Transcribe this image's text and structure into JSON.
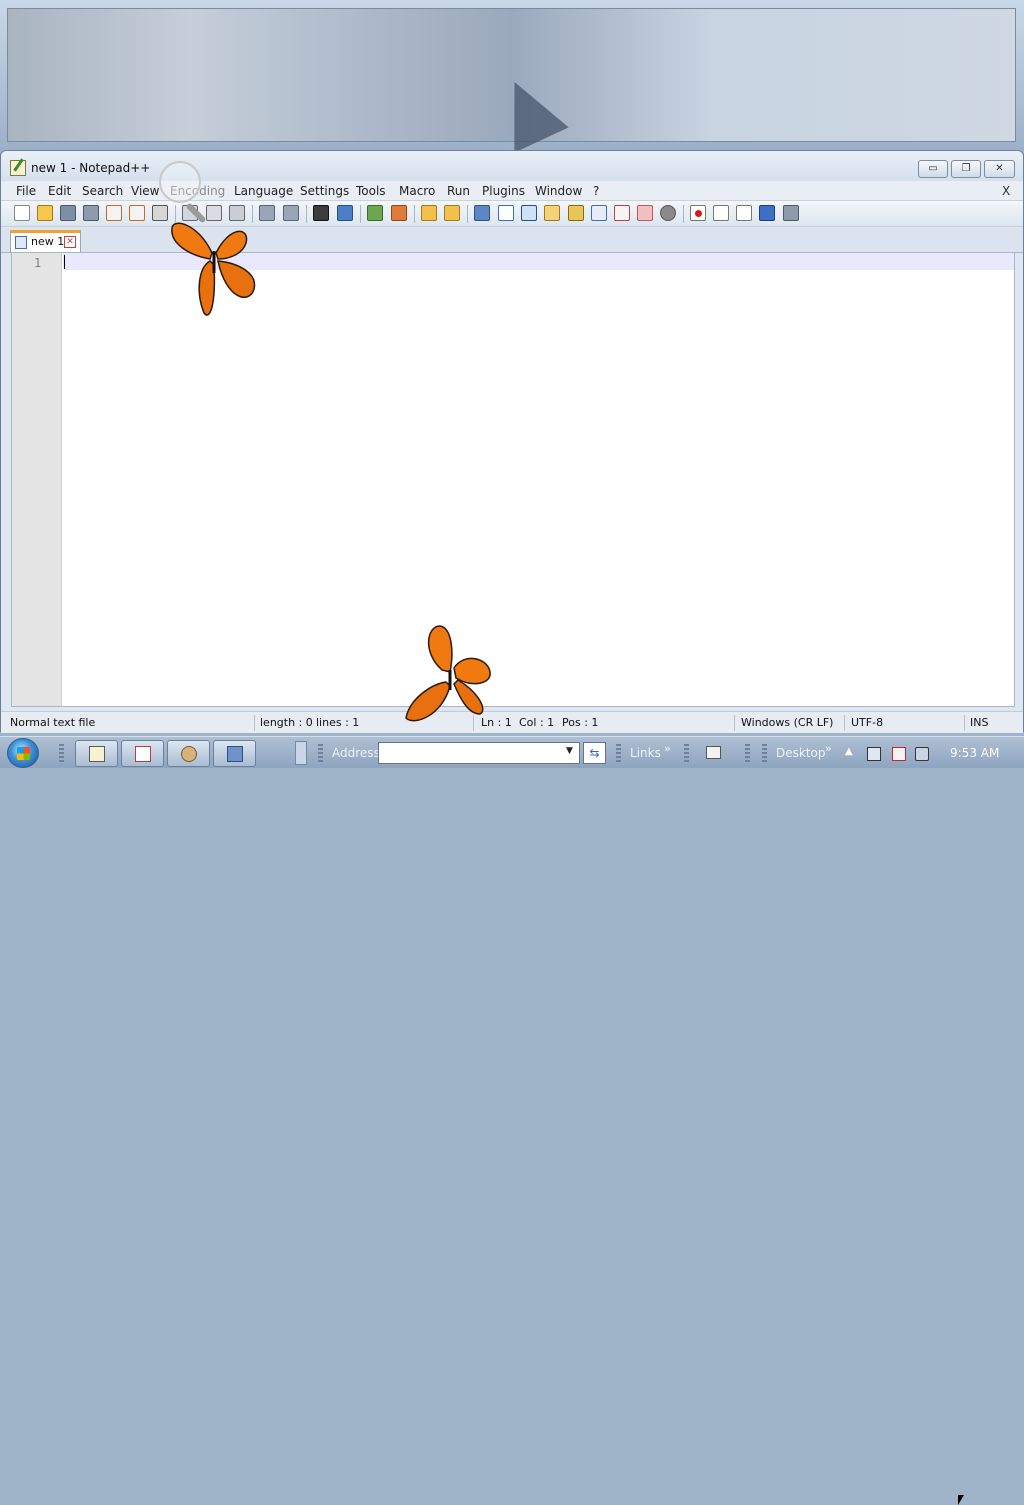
{
  "window": {
    "title": "new 1 - Notepad++",
    "minimize_label": "▭",
    "restore_label": "❐",
    "close_label": "✕"
  },
  "menu": {
    "items": [
      "File",
      "Edit",
      "Search",
      "View",
      "Encoding",
      "Language",
      "Settings",
      "Tools",
      "Macro",
      "Run",
      "Plugins",
      "Window",
      "?"
    ],
    "close_doc": "X"
  },
  "toolbar": {
    "icons": [
      "new-file-icon",
      "open-file-icon",
      "save-icon",
      "save-all-icon",
      "close-icon",
      "close-all-icon",
      "print-icon",
      "cut-icon",
      "copy-icon",
      "paste-icon",
      "undo-icon",
      "redo-icon",
      "find-icon",
      "replace-icon",
      "zoom-in-icon",
      "zoom-out-icon",
      "sync-vertical-icon",
      "sync-horizontal-icon",
      "word-wrap-icon",
      "show-all-chars-icon",
      "indent-guide-icon",
      "user-language-icon",
      "doc-map-icon",
      "function-list-icon",
      "folder-workspace-icon",
      "monitoring-icon",
      "record-macro-icon",
      "stop-macro-icon",
      "play-macro-icon",
      "run-macro-multiple-icon",
      "save-macro-icon"
    ]
  },
  "tabs": {
    "active": "new 1",
    "close_label": "✕"
  },
  "editor": {
    "line_numbers": [
      "1"
    ]
  },
  "status": {
    "file_type": "Normal text file",
    "length": "length : 0",
    "lines": "lines : 1",
    "ln": "Ln : 1",
    "col": "Col : 1",
    "pos": "Pos : 1",
    "eol": "Windows (CR LF)",
    "encoding": "UTF-8",
    "mode": "INS"
  },
  "taskbar": {
    "address_label": "Address",
    "address_value": "",
    "go_label": "⇆",
    "links_label": "Links",
    "desktop_label": "Desktop",
    "chevron": "»",
    "tray_expand": "▲",
    "clock": "9:53 AM"
  },
  "colors": {
    "accent": "#f0a030",
    "current_line": "#e8e8ff",
    "butterfly_orange": "#f07a10"
  }
}
